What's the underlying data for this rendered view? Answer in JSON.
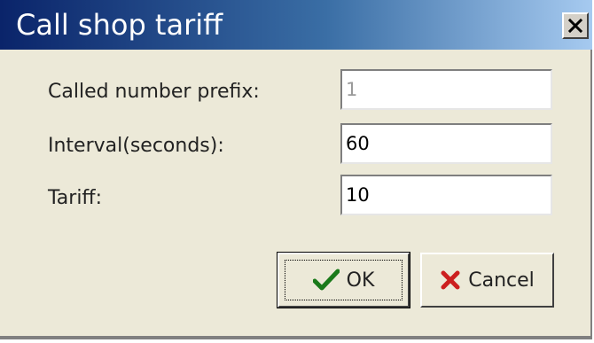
{
  "window": {
    "title": "Call shop tariff"
  },
  "form": {
    "prefix_label": "Called number prefix:",
    "prefix_value": "1",
    "interval_label": "Interval(seconds):",
    "interval_value": "60",
    "tariff_label": "Tariff:",
    "tariff_value": "10"
  },
  "buttons": {
    "ok_label": "OK",
    "cancel_label": "Cancel"
  },
  "icons": {
    "close": "close-icon",
    "ok": "checkmark-icon",
    "cancel": "red-x-icon"
  },
  "colors": {
    "title_bar_start": "#0a246a",
    "title_bar_end": "#a6caf0",
    "dialog_bg": "#ece9d8",
    "ok_check": "#1a7a1a",
    "cancel_x": "#cc1f1f"
  }
}
